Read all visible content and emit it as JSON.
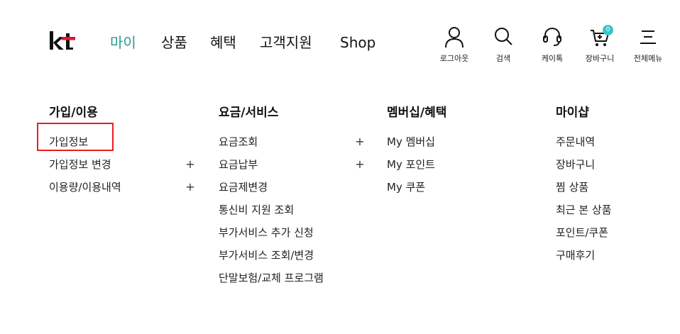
{
  "header": {
    "logo_text": "kt",
    "nav": [
      {
        "label": "마이",
        "active": true
      },
      {
        "label": "상품",
        "active": false
      },
      {
        "label": "혜택",
        "active": false
      },
      {
        "label": "고객지원",
        "active": false
      },
      {
        "label": "Shop",
        "active": false
      }
    ],
    "util": {
      "logout": "로그아웃",
      "search": "검색",
      "chat": "케이톡",
      "cart": "장바구니",
      "cart_count": "0",
      "menu": "전체메뉴"
    }
  },
  "columns": [
    {
      "title": "가입/이용",
      "items": [
        {
          "label": "가입정보",
          "expandable": false
        },
        {
          "label": "가입정보 변경",
          "expandable": true
        },
        {
          "label": "이용량/이용내역",
          "expandable": true
        }
      ]
    },
    {
      "title": "요금/서비스",
      "items": [
        {
          "label": "요금조회",
          "expandable": true
        },
        {
          "label": "요금납부",
          "expandable": true
        },
        {
          "label": "요금제변경",
          "expandable": false
        },
        {
          "label": "통신비 지원 조회",
          "expandable": false
        },
        {
          "label": "부가서비스 추가 신청",
          "expandable": false
        },
        {
          "label": "부가서비스 조회/변경",
          "expandable": false
        },
        {
          "label": "단말보험/교체 프로그램",
          "expandable": false
        }
      ]
    },
    {
      "title": "멤버십/혜택",
      "items": [
        {
          "label": "My 멤버십",
          "expandable": false
        },
        {
          "label": "My 포인트",
          "expandable": false
        },
        {
          "label": "My 쿠폰",
          "expandable": false
        }
      ]
    },
    {
      "title": "마이샵",
      "items": [
        {
          "label": "주문내역",
          "expandable": false
        },
        {
          "label": "장바구니",
          "expandable": false
        },
        {
          "label": "찜 상품",
          "expandable": false
        },
        {
          "label": "최근 본 상품",
          "expandable": false
        },
        {
          "label": "포인트/쿠폰",
          "expandable": false
        },
        {
          "label": "구매후기",
          "expandable": false
        }
      ]
    }
  ],
  "plus_symbol": "+",
  "colors": {
    "accent": "#2a9a91",
    "logo_red": "#e8112d",
    "badge": "#38c6c6",
    "highlight": "#e81f1f"
  }
}
